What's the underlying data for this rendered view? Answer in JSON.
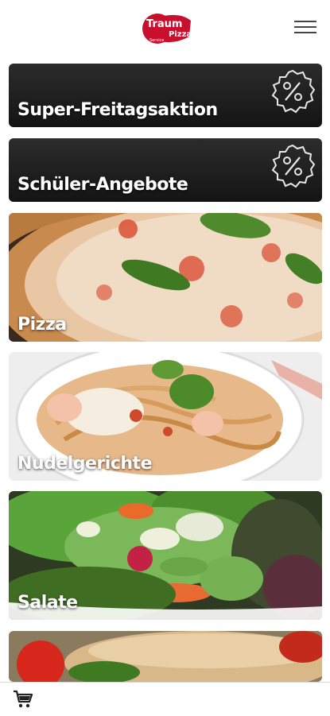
{
  "header": {
    "logo_text_1": "Traum",
    "logo_text_2": "Pizza",
    "logo_text_3": "Service",
    "menu_icon": "hamburger-menu-icon"
  },
  "categories": [
    {
      "label": "Super-Freitagsaktion",
      "icon": "percent-badge-icon"
    },
    {
      "label": "Schüler-Angebote",
      "icon": "percent-badge-icon"
    },
    {
      "label": "Pizza"
    },
    {
      "label": "Nudelgerichte"
    },
    {
      "label": "Salate"
    }
  ],
  "cart": {
    "icon": "shopping-cart-icon"
  },
  "colors": {
    "brand_red": "#c8102e",
    "promo_dark": "#1c1c1c"
  }
}
